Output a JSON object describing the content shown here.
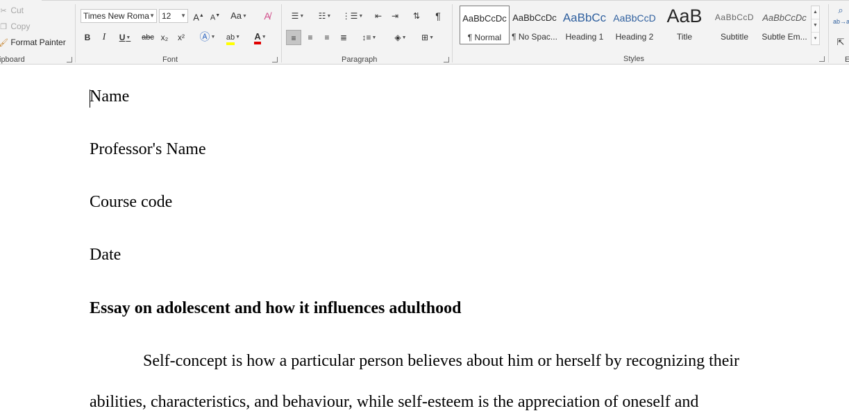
{
  "clipboard": {
    "cut_label": "Cut",
    "copy_label": "Copy",
    "format_painter_label": "Format Painter",
    "group_label": "ipboard"
  },
  "font": {
    "font_name": "Times New Roma",
    "font_size": "12",
    "bold": "B",
    "italic": "I",
    "underline": "U",
    "strike": "abc",
    "subscript": "x₂",
    "superscript": "x²",
    "case": "Aa",
    "grow": "A",
    "shrink": "A",
    "group_label": "Font",
    "highlight_color": "#ffff00",
    "font_color": "#e00000"
  },
  "paragraph": {
    "group_label": "Paragraph",
    "pilcrow": "¶"
  },
  "styles": {
    "group_label": "Styles",
    "items": [
      {
        "sample": "AaBbCcDc",
        "name": "¶ Normal"
      },
      {
        "sample": "AaBbCcDc",
        "name": "¶ No Spac..."
      },
      {
        "sample": "AaBbCc",
        "name": "Heading 1"
      },
      {
        "sample": "AaBbCcD",
        "name": "Heading 2"
      },
      {
        "sample": "AaB",
        "name": "Title"
      },
      {
        "sample": "AaBbCcD",
        "name": "Subtitle"
      },
      {
        "sample": "AaBbCcDc",
        "name": "Subtle Em..."
      }
    ]
  },
  "editing": {
    "group_label": "E",
    "replace_icon": "ab→ac"
  },
  "document": {
    "lines": [
      "Name",
      "Professor's Name",
      "Course code",
      "Date",
      "Essay on adolescent and how it influences adulthood",
      "Self-concept is how a particular person believes about him or herself by recognizing their",
      "abilities, characteristics, and behaviour, while self-esteem is the appreciation of oneself and"
    ]
  }
}
